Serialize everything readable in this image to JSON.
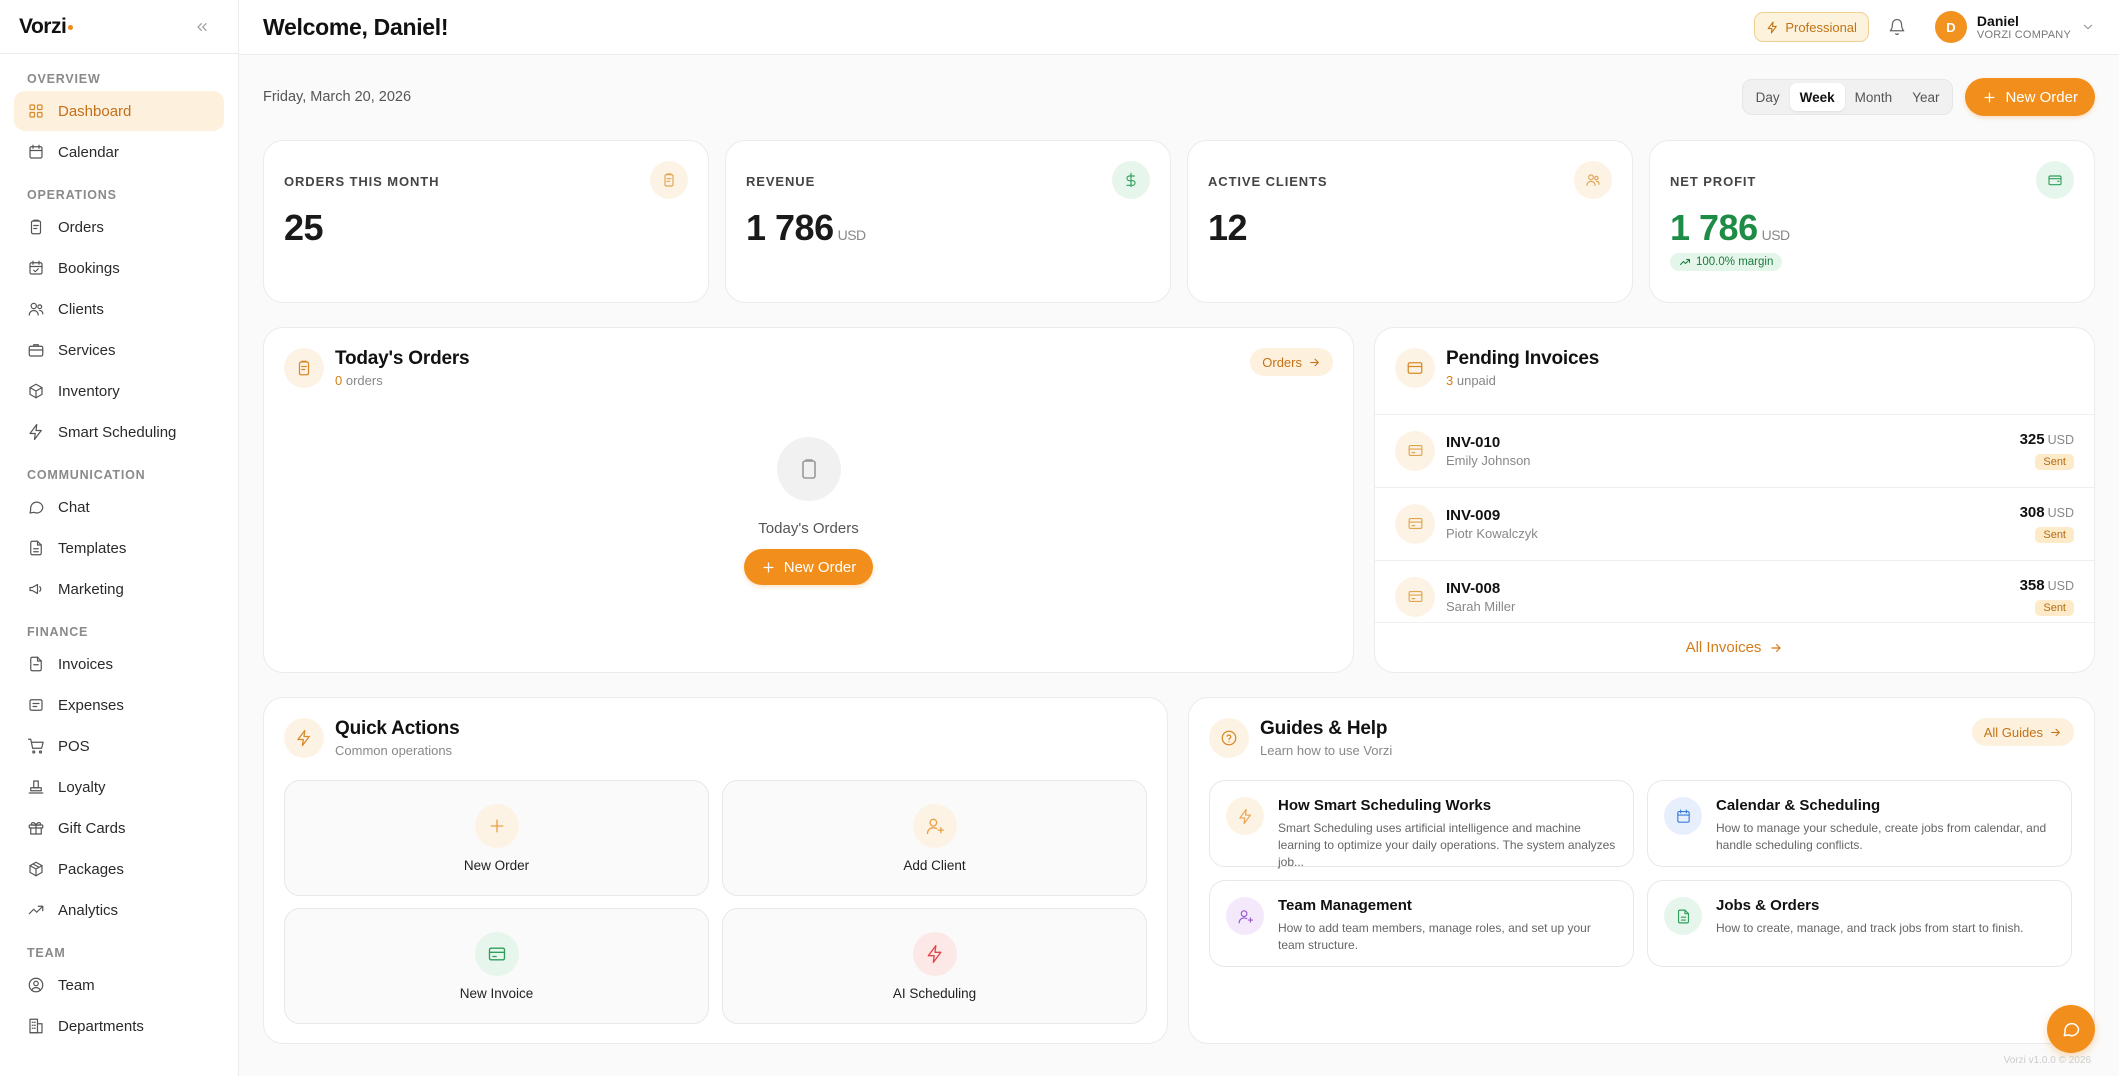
{
  "brand": {
    "name": "Vorzi"
  },
  "sidebar": {
    "sections": [
      {
        "title": "OVERVIEW",
        "items": [
          {
            "label": "Dashboard",
            "icon": "grid-icon",
            "active": true
          },
          {
            "label": "Calendar",
            "icon": "calendar-icon"
          }
        ]
      },
      {
        "title": "OPERATIONS",
        "items": [
          {
            "label": "Orders",
            "icon": "clipboard-icon"
          },
          {
            "label": "Bookings",
            "icon": "calendar-check-icon"
          },
          {
            "label": "Clients",
            "icon": "users-icon"
          },
          {
            "label": "Services",
            "icon": "briefcase-icon"
          },
          {
            "label": "Inventory",
            "icon": "box-icon"
          },
          {
            "label": "Smart Scheduling",
            "icon": "zap-icon"
          }
        ]
      },
      {
        "title": "COMMUNICATION",
        "items": [
          {
            "label": "Chat",
            "icon": "chat-icon"
          },
          {
            "label": "Templates",
            "icon": "file-text-icon"
          },
          {
            "label": "Marketing",
            "icon": "megaphone-icon"
          }
        ]
      },
      {
        "title": "FINANCE",
        "items": [
          {
            "label": "Invoices",
            "icon": "file-icon"
          },
          {
            "label": "Expenses",
            "icon": "receipt-icon"
          },
          {
            "label": "POS",
            "icon": "cart-icon"
          },
          {
            "label": "Loyalty",
            "icon": "award-icon"
          },
          {
            "label": "Gift Cards",
            "icon": "gift-icon"
          },
          {
            "label": "Packages",
            "icon": "package-icon"
          },
          {
            "label": "Analytics",
            "icon": "trend-icon"
          }
        ]
      },
      {
        "title": "TEAM",
        "items": [
          {
            "label": "Team",
            "icon": "user-circle-icon"
          },
          {
            "label": "Departments",
            "icon": "building-icon"
          }
        ]
      }
    ]
  },
  "topbar": {
    "welcome": "Welcome, Daniel!",
    "plan": "Professional",
    "user": {
      "initial": "D",
      "name": "Daniel",
      "company": "VORZI COMPANY"
    }
  },
  "main": {
    "date": "Friday, March 20, 2026",
    "periods": [
      "Day",
      "Week",
      "Month",
      "Year"
    ],
    "selected_period": "Week",
    "new_order_label": "New Order",
    "stats": [
      {
        "label": "ORDERS THIS MONTH",
        "value": "25",
        "unit": "",
        "icon": "clipboard-icon"
      },
      {
        "label": "REVENUE",
        "value": "1 786",
        "unit": "USD",
        "icon": "dollar-icon"
      },
      {
        "label": "ACTIVE CLIENTS",
        "value": "12",
        "unit": "",
        "icon": "users-icon"
      },
      {
        "label": "NET PROFIT",
        "value": "1 786",
        "unit": "USD",
        "icon": "wallet-icon",
        "badge": "100.0% margin"
      }
    ],
    "todays_orders": {
      "title": "Today's Orders",
      "count": "0",
      "count_suffix": "orders",
      "link": "Orders",
      "empty_label": "Today's Orders",
      "empty_button": "New Order"
    },
    "pending_invoices": {
      "title": "Pending Invoices",
      "count": "3",
      "count_suffix": "unpaid",
      "rows": [
        {
          "id": "INV-010",
          "client": "Emily Johnson",
          "amount": "325",
          "currency": "USD",
          "status": "Sent"
        },
        {
          "id": "INV-009",
          "client": "Piotr Kowalczyk",
          "amount": "308",
          "currency": "USD",
          "status": "Sent"
        },
        {
          "id": "INV-008",
          "client": "Sarah Miller",
          "amount": "358",
          "currency": "USD",
          "status": "Sent"
        }
      ],
      "all_link": "All Invoices"
    },
    "quick_actions": {
      "title": "Quick Actions",
      "subtitle": "Common operations",
      "items": [
        {
          "label": "New Order",
          "icon": "plus-icon",
          "color": "#e8a14a",
          "bg": "#fdf3e4"
        },
        {
          "label": "Add Client",
          "icon": "user-plus-icon",
          "color": "#e8a14a",
          "bg": "#fdf3e4"
        },
        {
          "label": "New Invoice",
          "icon": "credit-card-icon",
          "color": "#2f9e5b",
          "bg": "#e6f6ec"
        },
        {
          "label": "AI Scheduling",
          "icon": "zap-icon",
          "color": "#e0474c",
          "bg": "#fde8e8"
        }
      ]
    },
    "guides": {
      "title": "Guides & Help",
      "subtitle": "Learn how to use Vorzi",
      "link": "All Guides",
      "items": [
        {
          "title": "How Smart Scheduling Works",
          "desc": "Smart Scheduling uses artificial intelligence and machine learning to optimize your daily operations. The system analyzes job...",
          "icon": "zap-icon",
          "color": "#e8a14a",
          "bg": "#fdf3e4"
        },
        {
          "title": "Calendar & Scheduling",
          "desc": "How to manage your schedule, create jobs from calendar, and handle scheduling conflicts.",
          "icon": "calendar-icon",
          "color": "#3b7be0",
          "bg": "#e7effc"
        },
        {
          "title": "Team Management",
          "desc": "How to add team members, manage roles, and set up your team structure.",
          "icon": "user-plus-icon",
          "color": "#9b59d0",
          "bg": "#f3e9fb"
        },
        {
          "title": "Jobs & Orders",
          "desc": "How to create, manage, and track jobs from start to finish.",
          "icon": "file-text-icon",
          "color": "#2f9e5b",
          "bg": "#e6f6ec"
        }
      ]
    },
    "version": "Vorzi v1.0.0 © 2026"
  },
  "colors": {
    "accent": "#f28f1c",
    "accent_soft": "#fdf0dc",
    "success": "#1e8c47"
  }
}
